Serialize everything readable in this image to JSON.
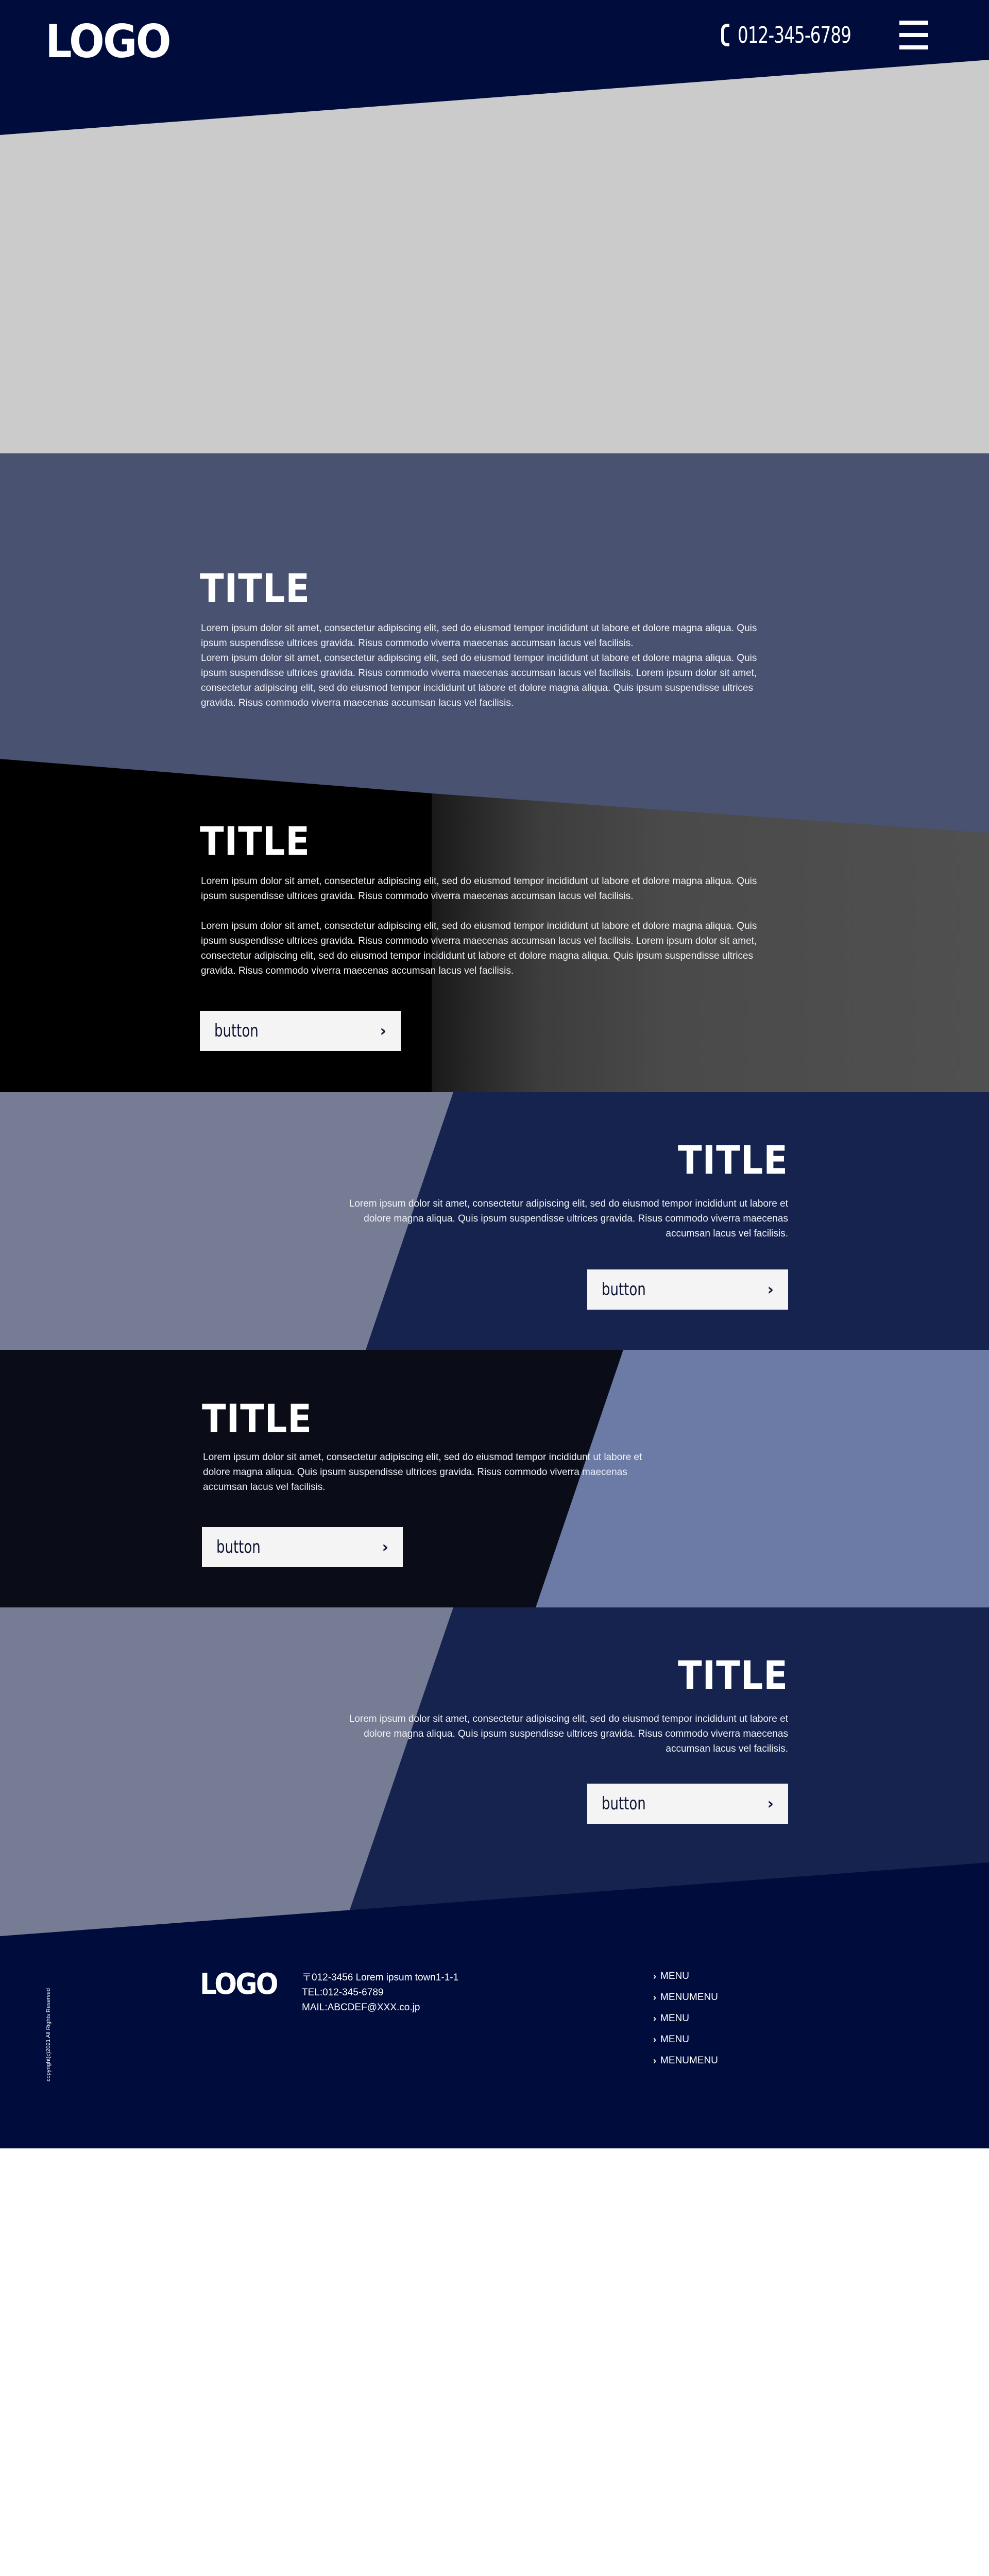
{
  "header": {
    "logo": "LOGO",
    "phone_icon": "phone-icon",
    "phone": "012-345-6789",
    "menu_icon": "hamburger-menu-icon"
  },
  "section1": {
    "title": "TITLE",
    "paragraphs": [
      "Lorem ipsum dolor sit amet, consectetur adipiscing elit, sed do eiusmod tempor incididunt ut labore et dolore magna aliqua. Quis ipsum suspendisse ultrices gravida. Risus commodo viverra maecenas accumsan lacus vel facilisis.",
      "Lorem ipsum dolor sit amet, consectetur adipiscing elit, sed do eiusmod tempor incididunt ut labore et dolore magna aliqua. Quis ipsum suspendisse ultrices gravida. Risus commodo viverra maecenas accumsan lacus vel facilisis. Lorem ipsum dolor sit amet, consectetur adipiscing elit, sed do eiusmod tempor incididunt ut labore et dolore magna aliqua. Quis ipsum suspendisse ultrices gravida. Risus commodo viverra maecenas accumsan lacus vel facilisis."
    ]
  },
  "section2": {
    "title": "TITLE",
    "paragraphs": [
      "Lorem ipsum dolor sit amet, consectetur adipiscing elit, sed do eiusmod tempor incididunt ut labore et dolore magna aliqua. Quis ipsum suspendisse ultrices gravida. Risus commodo viverra maecenas accumsan lacus vel facilisis.",
      "Lorem ipsum dolor sit amet, consectetur adipiscing elit, sed do eiusmod tempor incididunt ut labore et dolore magna aliqua. Quis ipsum suspendisse ultrices gravida. Risus commodo viverra maecenas accumsan lacus vel facilisis. Lorem ipsum dolor sit amet, consectetur adipiscing elit, sed do eiusmod tempor incididunt ut labore et dolore magna aliqua. Quis ipsum suspendisse ultrices gravida. Risus commodo viverra maecenas accumsan lacus vel facilisis."
    ],
    "button": "button"
  },
  "section3": {
    "title": "TITLE",
    "paragraph": "Lorem ipsum dolor sit amet, consectetur adipiscing elit, sed do eiusmod tempor incididunt ut labore et dolore magna aliqua. Quis ipsum suspendisse ultrices gravida. Risus commodo viverra maecenas accumsan lacus vel facilisis.",
    "button": "button"
  },
  "section4": {
    "title": "TITLE",
    "paragraph": "Lorem ipsum dolor sit amet, consectetur adipiscing elit, sed do eiusmod tempor incididunt ut labore et dolore magna aliqua. Quis ipsum suspendisse ultrices gravida. Risus commodo viverra maecenas accumsan lacus vel facilisis.",
    "button": "button"
  },
  "section5": {
    "title": "TITLE",
    "paragraph": "Lorem ipsum dolor sit amet, consectetur adipiscing elit, sed do eiusmod tempor incididunt ut labore et dolore magna aliqua. Quis ipsum suspendisse ultrices gravida. Risus commodo viverra maecenas accumsan lacus vel facilisis.",
    "button": "button"
  },
  "footer": {
    "copyright": "copyright(c)2021 All Rights Reserved",
    "logo": "LOGO",
    "address": "〒012-3456 Lorem ipsum town1-1-1",
    "tel": "TEL:012-345-6789",
    "mail": "MAIL:ABCDEF@XXX.co.jp",
    "menu": [
      "MENU",
      "MENUMENU",
      "MENU",
      "MENU",
      "MENUMENU"
    ]
  },
  "colors": {
    "navy_dark": "#000d3c",
    "slate": "#4a5271",
    "navy": "#15234e",
    "grey_blue": "#767c93",
    "periwinkle": "#6c7aa6",
    "hero_placeholder": "#cbcbcb",
    "button_bg": "#f4f4f4"
  }
}
